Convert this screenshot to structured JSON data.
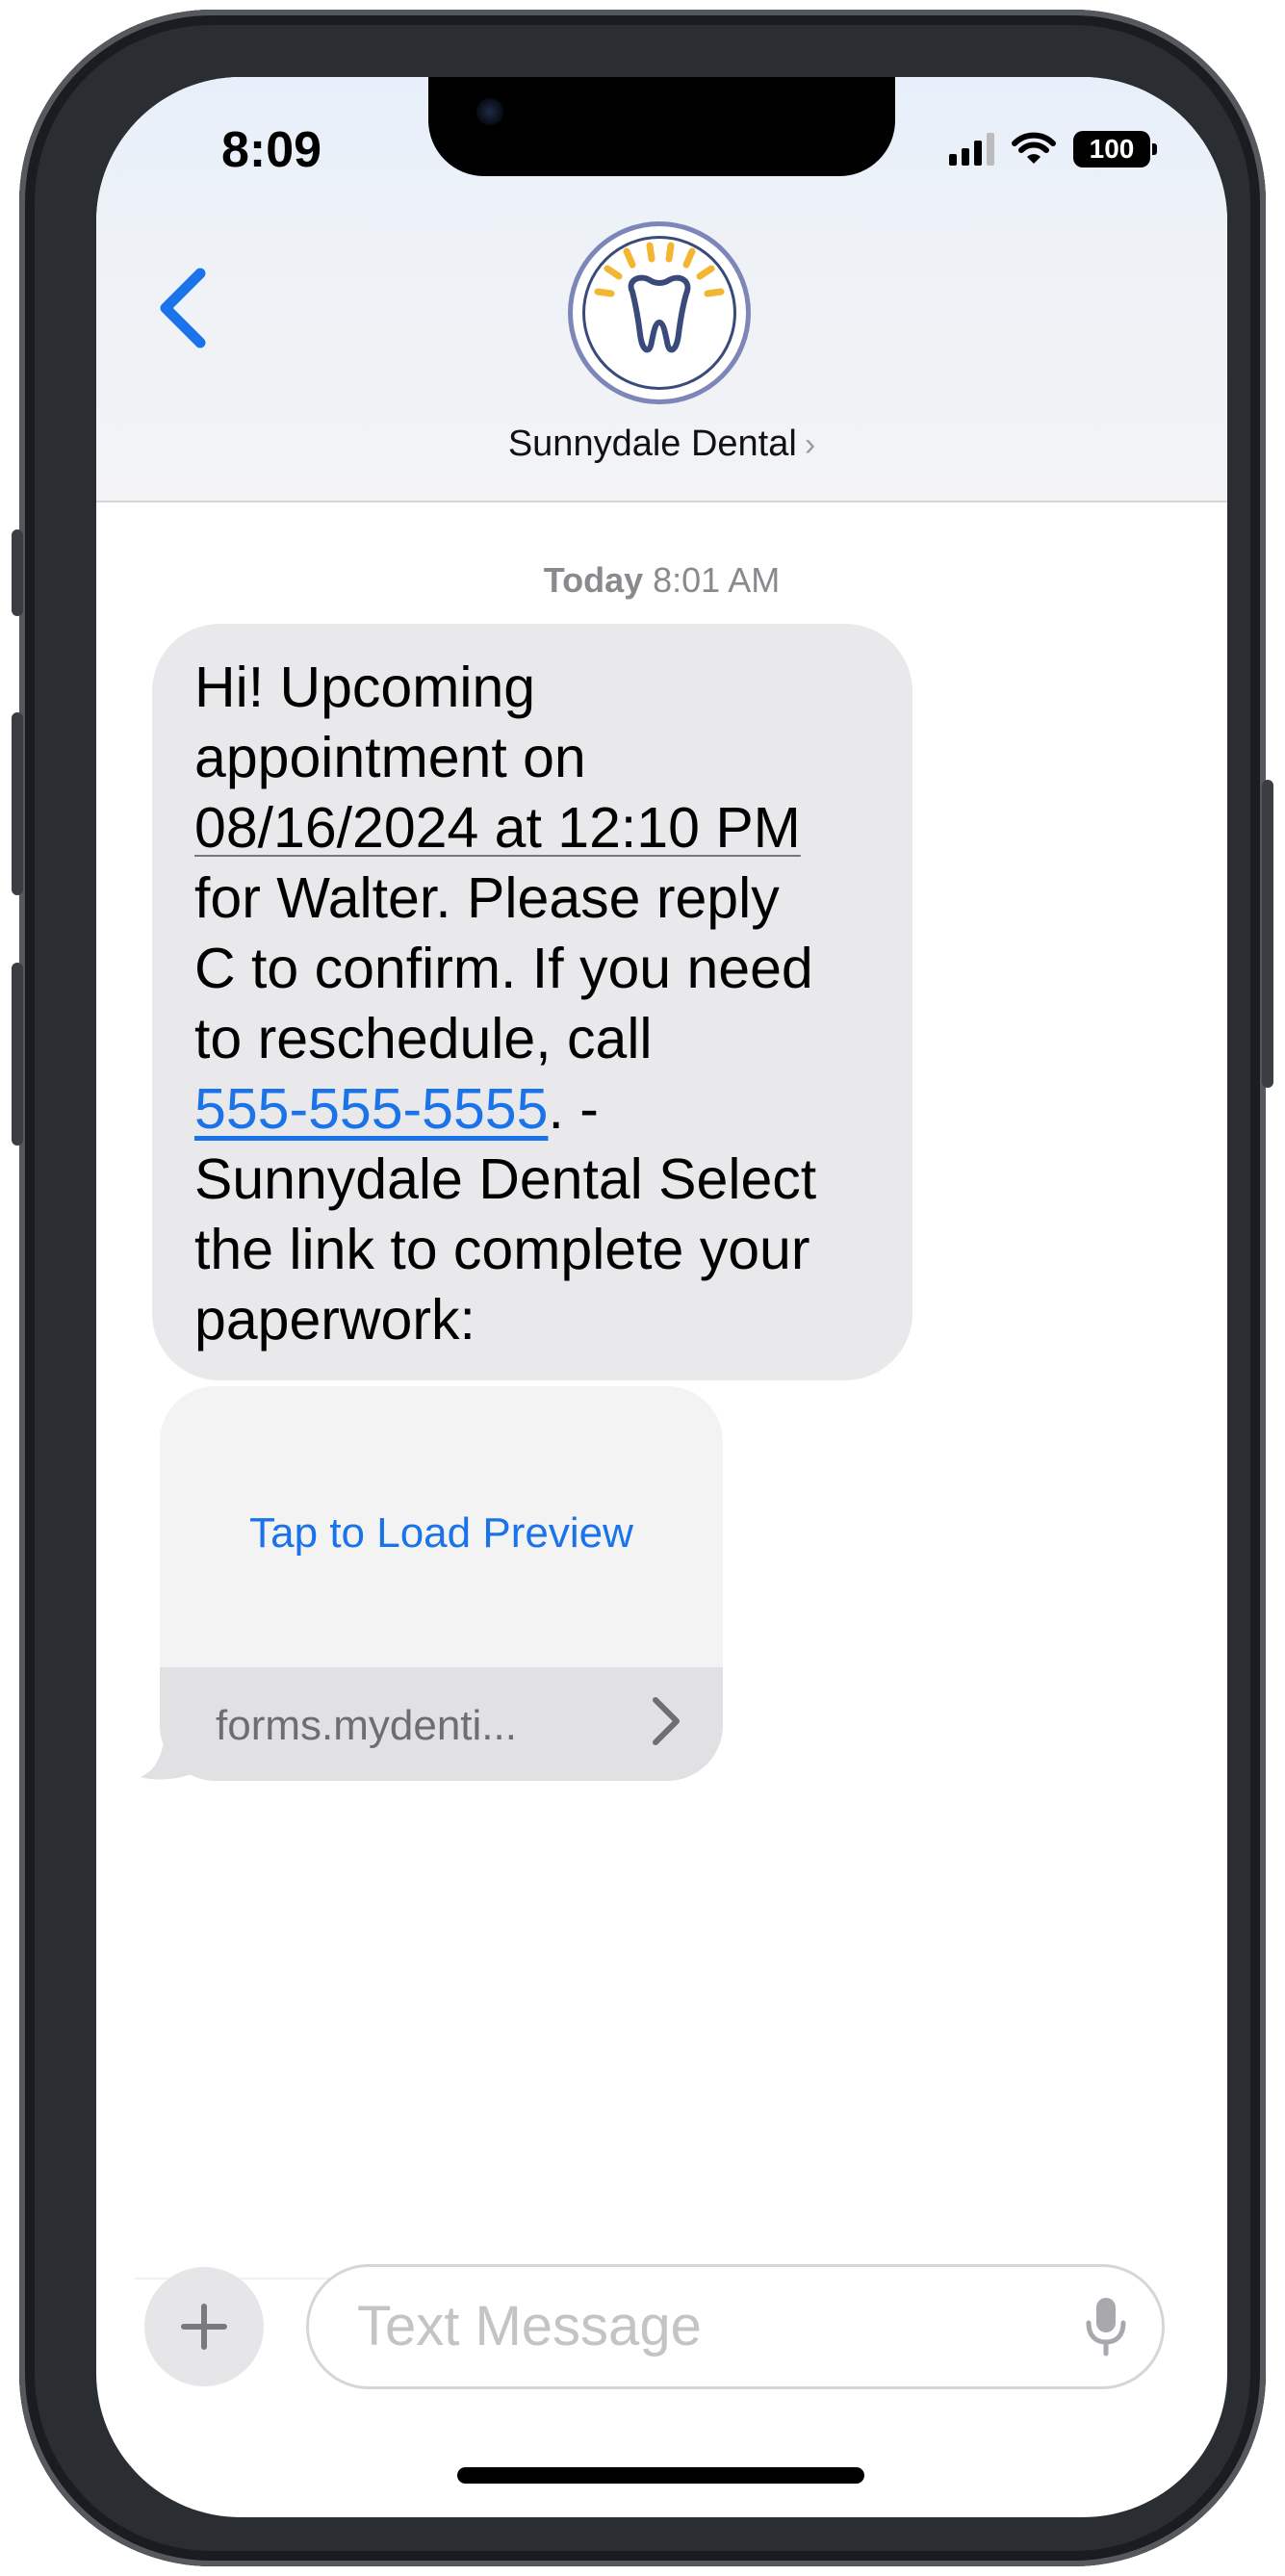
{
  "status_bar": {
    "time": "8:09",
    "battery": "100"
  },
  "header": {
    "contact_name": "Sunnydale Dental",
    "chevron": "›"
  },
  "thread": {
    "timestamp_day": "Today",
    "timestamp_time": "8:01 AM",
    "message_lines": [
      "Hi! Upcoming",
      "appointment on",
      "08/16/2024 at 12:10 PM",
      "for  Walter.  Please reply",
      "C to confirm. If you need",
      "to reschedule, call",
      "555-555-5555",
      ". -",
      "Sunnydale Dental  Select",
      "the link to complete your",
      "paperwork:"
    ],
    "link_preview": {
      "load_label": "Tap to Load Preview",
      "url": "forms.mydenti..."
    }
  },
  "composer": {
    "placeholder": "Text Message"
  },
  "colors": {
    "link": "#1a73e8",
    "bubble": "#e9e9eb",
    "accent": "#1a73e8"
  }
}
